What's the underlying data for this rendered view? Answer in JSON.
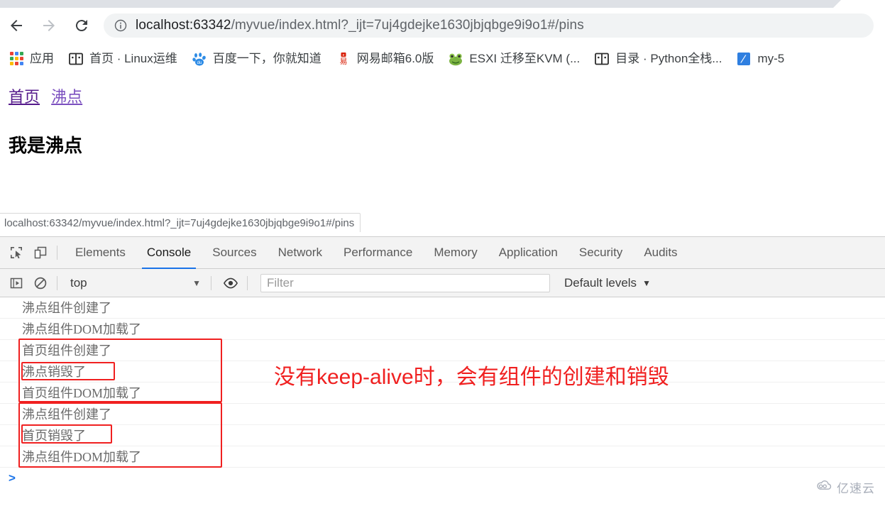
{
  "browser": {
    "nav": {
      "back_label": "Back",
      "forward_label": "Forward",
      "reload_label": "Reload"
    },
    "omnibox": {
      "security_icon": "info-circle-icon",
      "url_host": "localhost:63342",
      "url_path": "/myvue/index.html?_ijt=7uj4gdejke1630jbjqbge9i9o1#/pins",
      "url_full": "localhost:63342/myvue/index.html?_ijt=7uj4gdejke1630jbjqbge9i9o1#/pins"
    },
    "bookmarks": [
      {
        "label": "应用",
        "icon": "apps-grid-icon"
      },
      {
        "label": "首页 · Linux运维",
        "icon": "book-icon"
      },
      {
        "label": "百度一下，你就知道",
        "icon": "baidu-paw-icon"
      },
      {
        "label": "网易邮箱6.0版",
        "icon": "netease-mail-icon"
      },
      {
        "label": "ESXI 迁移至KVM (...",
        "icon": "frog-icon"
      },
      {
        "label": "目录 · Python全栈...",
        "icon": "book-icon"
      },
      {
        "label": "my-5",
        "icon": "pen-icon"
      }
    ]
  },
  "page": {
    "links": [
      {
        "label": "首页",
        "state": "visited"
      },
      {
        "label": "沸点",
        "state": "unvisited"
      }
    ],
    "heading": "我是沸点"
  },
  "status_bubble": {
    "text": "localhost:63342/myvue/index.html?_ijt=7uj4gdejke1630jbjqbge9i9o1#/pins"
  },
  "devtools": {
    "toolbar_icons": [
      {
        "name": "inspect-element-icon"
      },
      {
        "name": "device-toolbar-icon"
      }
    ],
    "tabs": [
      {
        "label": "Elements",
        "active": false
      },
      {
        "label": "Console",
        "active": true
      },
      {
        "label": "Sources",
        "active": false
      },
      {
        "label": "Network",
        "active": false
      },
      {
        "label": "Performance",
        "active": false
      },
      {
        "label": "Memory",
        "active": false
      },
      {
        "label": "Application",
        "active": false
      },
      {
        "label": "Security",
        "active": false
      },
      {
        "label": "Audits",
        "active": false
      }
    ],
    "console_toolbar": {
      "execute_icon": "execution-context-icon",
      "clear_icon": "clear-console-icon",
      "context_value": "top",
      "eye_icon": "live-expression-icon",
      "filter_placeholder": "Filter",
      "filter_value": "",
      "levels_label": "Default levels"
    },
    "console_logs": [
      {
        "text": "沸点组件创建了"
      },
      {
        "text": "沸点组件DOM加载了"
      },
      {
        "text": "首页组件创建了"
      },
      {
        "text": "沸点销毁了"
      },
      {
        "text": "首页组件DOM加载了"
      },
      {
        "text": "沸点组件创建了"
      },
      {
        "text": "首页销毁了"
      },
      {
        "text": "沸点组件DOM加载了"
      }
    ],
    "prompt_symbol": ">"
  },
  "annotations": {
    "note": "没有keep-alive时，会有组件的创建和销毁",
    "color": "#f02020"
  },
  "watermark": {
    "text": "亿速云",
    "icon": "cloud-icon"
  }
}
